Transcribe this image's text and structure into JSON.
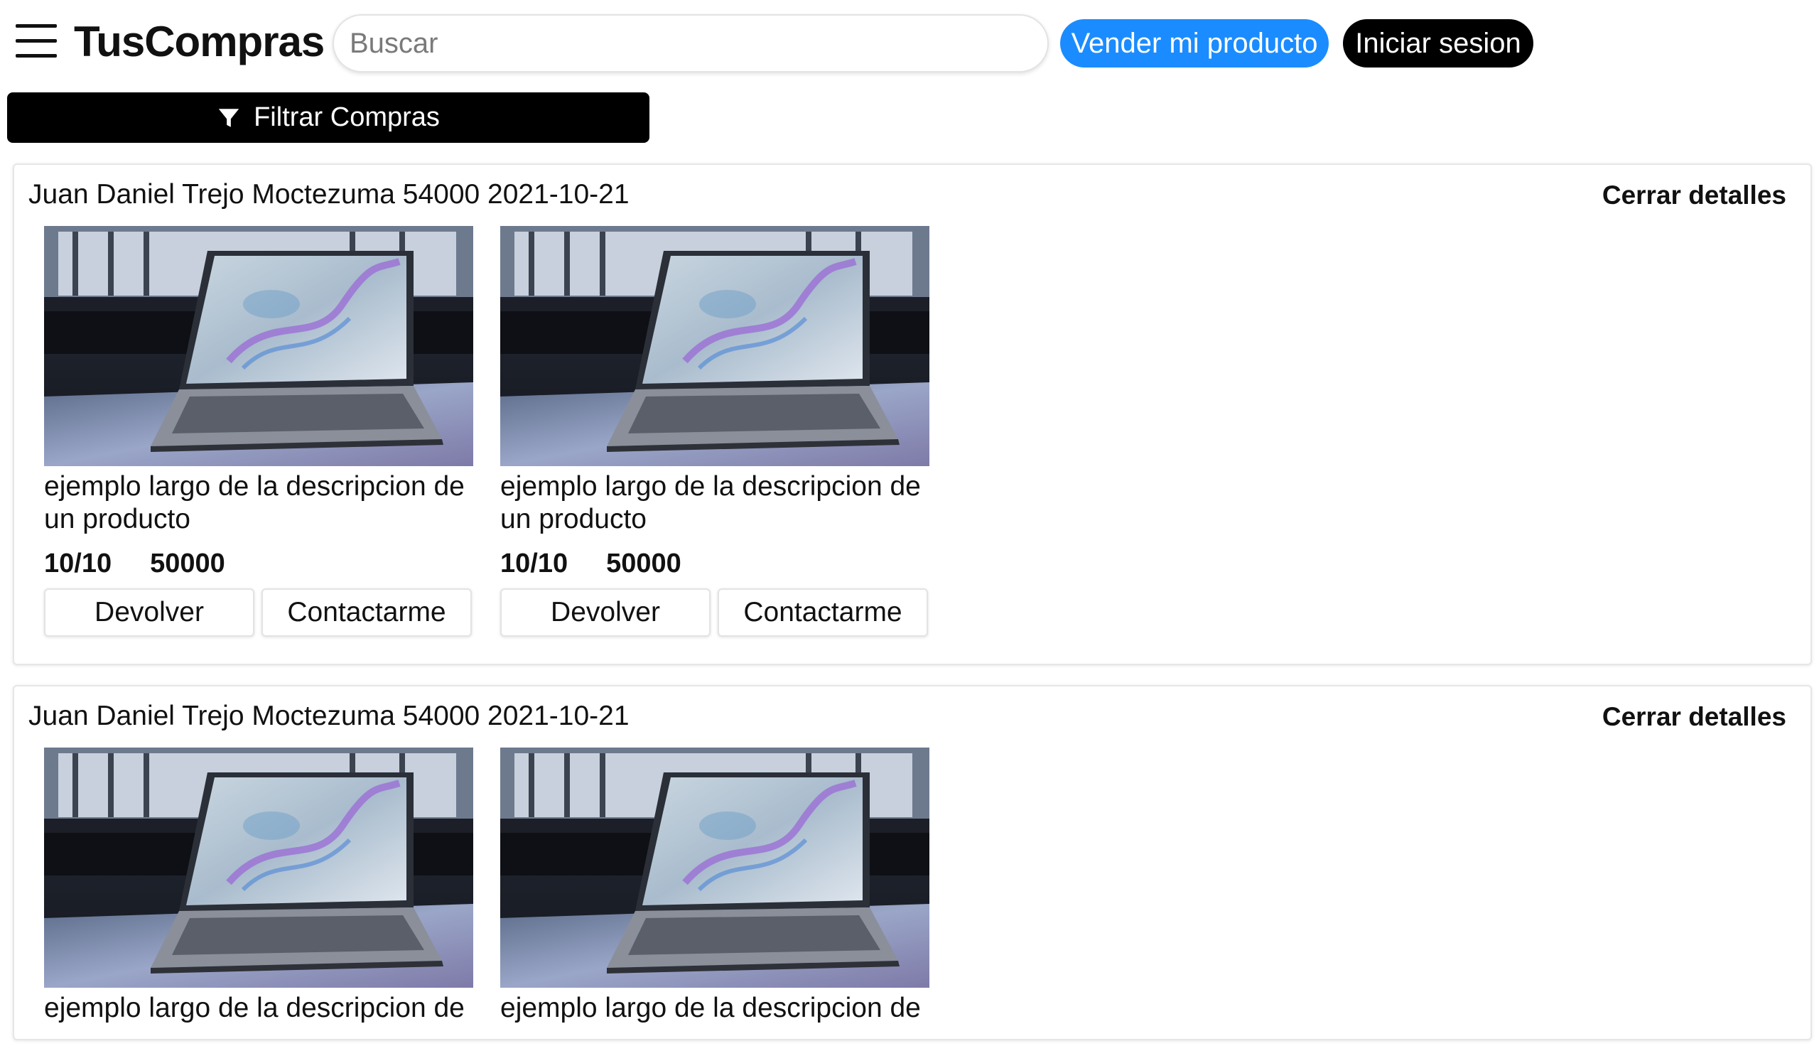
{
  "header": {
    "logo": "TusCompras",
    "search_placeholder": "Buscar",
    "sell_label": "Vender mi producto",
    "login_label": "Iniciar sesion"
  },
  "filter": {
    "label": "Filtrar Compras"
  },
  "orders": [
    {
      "heading": "Juan Daniel Trejo Moctezuma 54000 2021-10-21",
      "close_label": "Cerrar detalles",
      "products": [
        {
          "description": "ejemplo largo de la descripcion de un producto",
          "rating": "10/10",
          "price": "50000",
          "return_label": "Devolver",
          "contact_label": "Contactarme"
        },
        {
          "description": "ejemplo largo de la descripcion de un producto",
          "rating": "10/10",
          "price": "50000",
          "return_label": "Devolver",
          "contact_label": "Contactarme"
        }
      ]
    },
    {
      "heading": "Juan Daniel Trejo Moctezuma 54000 2021-10-21",
      "close_label": "Cerrar detalles",
      "products": [
        {
          "description": "ejemplo largo de la descripcion de",
          "rating": "",
          "price": "",
          "return_label": "",
          "contact_label": ""
        },
        {
          "description": "ejemplo largo de la descripcion de",
          "rating": "",
          "price": "",
          "return_label": "",
          "contact_label": ""
        }
      ]
    }
  ],
  "colors": {
    "accent": "#1a8cff",
    "dark": "#000000"
  },
  "icons": {
    "menu": "hamburger-menu-icon",
    "filter": "funnel-icon"
  }
}
